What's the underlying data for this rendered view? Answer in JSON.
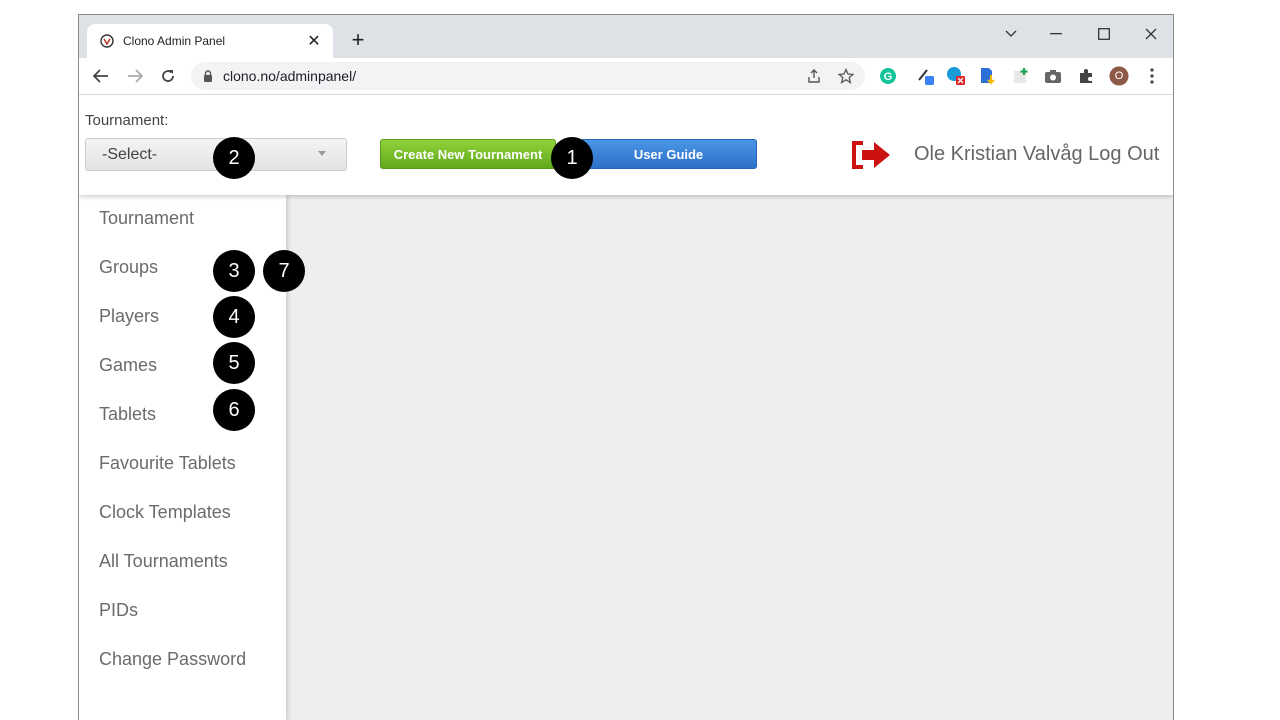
{
  "browser": {
    "tab_title": "Clono Admin Panel",
    "tab_close": "✕",
    "new_tab": "+",
    "url": "clono.no/adminpanel/",
    "profile_initial": "O"
  },
  "header": {
    "tournament_label": "Tournament:",
    "select_value": "-Select-",
    "create_button": "Create New Tournament",
    "guide_button": "User Guide",
    "user_logout": "Ole Kristian Valvåg Log Out"
  },
  "sidebar": {
    "items": [
      {
        "label": "Tournament"
      },
      {
        "label": "Groups"
      },
      {
        "label": "Players"
      },
      {
        "label": "Games"
      },
      {
        "label": "Tablets"
      },
      {
        "label": "Favourite Tablets"
      },
      {
        "label": "Clock Templates"
      },
      {
        "label": "All Tournaments"
      },
      {
        "label": "PIDs"
      },
      {
        "label": "Change Password"
      }
    ]
  },
  "callouts": [
    "1",
    "2",
    "3",
    "4",
    "5",
    "6",
    "7"
  ],
  "colors": {
    "create_button": "#6cb823",
    "guide_button": "#3a82d8",
    "logout_icon": "#cc1111",
    "content_bg": "#eeeeee"
  },
  "icons": [
    "clono-favicon",
    "back-arrow-icon",
    "forward-arrow-icon",
    "reload-icon",
    "lock-icon",
    "share-icon",
    "star-icon",
    "grammarly-icon",
    "extension-icon",
    "puzzle-icon",
    "camera-icon",
    "kebab-menu-icon",
    "logout-icon"
  ]
}
